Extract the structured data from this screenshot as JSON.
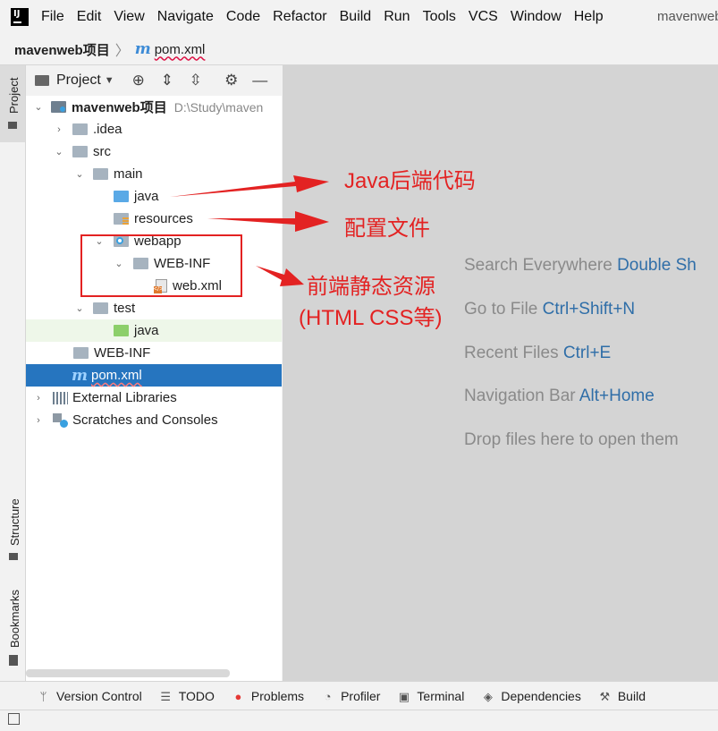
{
  "menubar": {
    "items": [
      "File",
      "Edit",
      "View",
      "Navigate",
      "Code",
      "Refactor",
      "Build",
      "Run",
      "Tools",
      "VCS",
      "Window",
      "Help"
    ],
    "project_name": "mavenweb"
  },
  "breadcrumb": {
    "project": "mavenweb项目",
    "file": "pom.xml"
  },
  "left_strip": {
    "project": "Project",
    "structure": "Structure",
    "bookmarks": "Bookmarks"
  },
  "panel": {
    "dropdown_label": "Project"
  },
  "tree": {
    "root_name": "mavenweb项目",
    "root_path": "D:\\Study\\maven",
    "idea": ".idea",
    "src": "src",
    "main": "main",
    "java": "java",
    "resources": "resources",
    "webapp": "webapp",
    "webinf": "WEB-INF",
    "webxml": "web.xml",
    "test": "test",
    "test_java": "java",
    "root_webinf": "WEB-INF",
    "pom": "pom.xml",
    "ext_libs": "External Libraries",
    "scratches": "Scratches and Consoles"
  },
  "editor_hints": [
    {
      "text": "Search Everywhere",
      "key": "Double Sh"
    },
    {
      "text": "Go to File",
      "key": "Ctrl+Shift+N"
    },
    {
      "text": "Recent Files",
      "key": "Ctrl+E"
    },
    {
      "text": "Navigation Bar",
      "key": "Alt+Home"
    },
    {
      "text": "Drop files here to open them",
      "key": ""
    }
  ],
  "annotations": {
    "java": "Java后端代码",
    "config": "配置文件",
    "frontend_1": "前端静态资源",
    "frontend_2": "(HTML CSS等)"
  },
  "annotation_color": "#e32222",
  "bottom_tools": {
    "version_control": "Version Control",
    "todo": "TODO",
    "problems": "Problems",
    "profiler": "Profiler",
    "terminal": "Terminal",
    "dependencies": "Dependencies",
    "build": "Build"
  }
}
